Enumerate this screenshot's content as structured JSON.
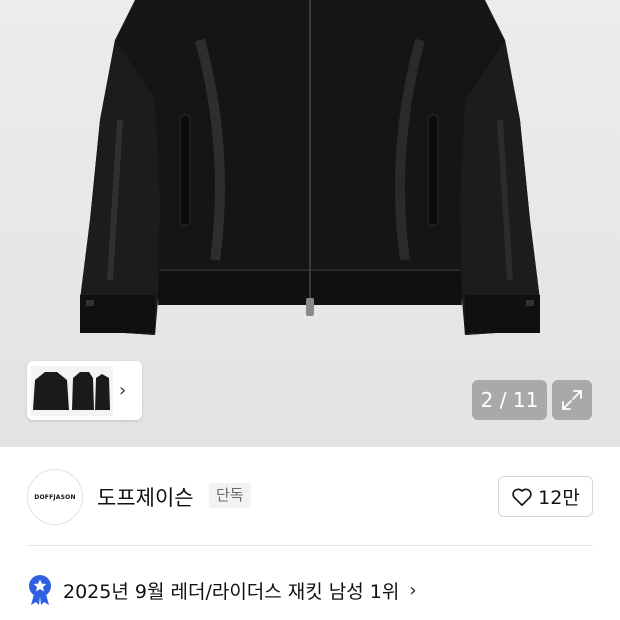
{
  "gallery": {
    "counter": "2 / 11",
    "thumbnail_next_icon": "chevron-right-icon",
    "expand_icon": "expand-icon"
  },
  "brand": {
    "logo_text": "DOFFJASON",
    "name": "도프제이슨",
    "badge": "단독",
    "like_icon": "heart-icon",
    "like_count": "12만"
  },
  "ranking": {
    "icon": "ranking-badge-icon",
    "text": "2025년 9월 레더/라이더스 재킷 남성 1위",
    "chevron_icon": "chevron-right-icon"
  },
  "colors": {
    "accent": "#2f5fe0",
    "gallery_bg": "#e6e6e6",
    "counter_bg": "#969696"
  }
}
